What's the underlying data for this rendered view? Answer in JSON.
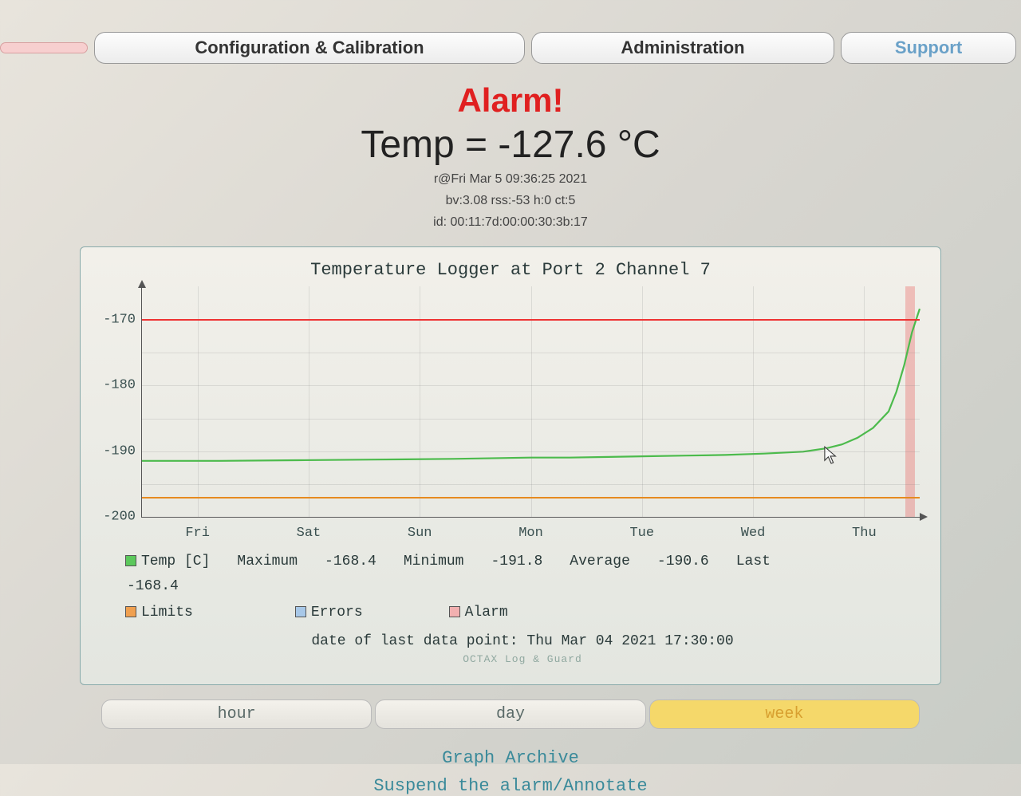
{
  "tabs": {
    "config": "Configuration & Calibration",
    "admin": "Administration",
    "support": "Support"
  },
  "header": {
    "alarm": "Alarm!",
    "temp_line": "Temp = -127.6 °C",
    "meta1": "r@Fri Mar 5 09:36:25 2021",
    "meta2": "bv:3.08 rss:-53 h:0 ct:5",
    "meta3": "id: 00:11:7d:00:00:30:3b:17"
  },
  "chart_title": "Temperature Logger at Port 2 Channel 7",
  "yticks": [
    "-170",
    "-180",
    "-190",
    "-200"
  ],
  "xticks": [
    "Fri",
    "Sat",
    "Sun",
    "Mon",
    "Tue",
    "Wed",
    "Thu"
  ],
  "legend": {
    "temp": "Temp [C]",
    "temp_last_below": "-168.4",
    "limits": "Limits",
    "errors": "Errors",
    "alarm": "Alarm",
    "max_lbl": "Maximum",
    "max_val": "-168.4",
    "min_lbl": "Minimum",
    "min_val": "-191.8",
    "avg_lbl": "Average",
    "avg_val": "-190.6",
    "last_lbl": "Last"
  },
  "last_point": "date of last data point:  Thu Mar 04 2021 17:30:00",
  "watermark": "OCTAX Log & Guard",
  "range": {
    "hour": "hour",
    "day": "day",
    "week": "week"
  },
  "links": {
    "archive": "Graph Archive",
    "suspend": "Suspend the alarm/Annotate"
  },
  "chart_data": {
    "type": "line",
    "title": "Temperature Logger at Port 2 Channel 7",
    "xlabel": "",
    "ylabel": "",
    "ylim": [
      -200,
      -165
    ],
    "xticks": [
      "Fri",
      "Sat",
      "Sun",
      "Mon",
      "Tue",
      "Wed",
      "Thu"
    ],
    "limits": {
      "upper": -170,
      "lower": -197
    },
    "series": [
      {
        "name": "Temp [C]",
        "x": [
          0,
          0.1,
          0.2,
          0.3,
          0.4,
          0.5,
          0.55,
          0.6,
          0.65,
          0.7,
          0.75,
          0.8,
          0.85,
          0.88,
          0.9,
          0.92,
          0.94,
          0.96,
          0.97,
          0.98,
          0.99,
          1.0
        ],
        "y": [
          -191.5,
          -191.5,
          -191.4,
          -191.3,
          -191.2,
          -191.0,
          -191.0,
          -190.9,
          -190.8,
          -190.7,
          -190.6,
          -190.4,
          -190.1,
          -189.6,
          -189.0,
          -188.0,
          -186.5,
          -184.0,
          -181.0,
          -177.0,
          -172.0,
          -168.4
        ]
      }
    ],
    "alarm_region_x": [
      0.985,
      1.0
    ]
  }
}
